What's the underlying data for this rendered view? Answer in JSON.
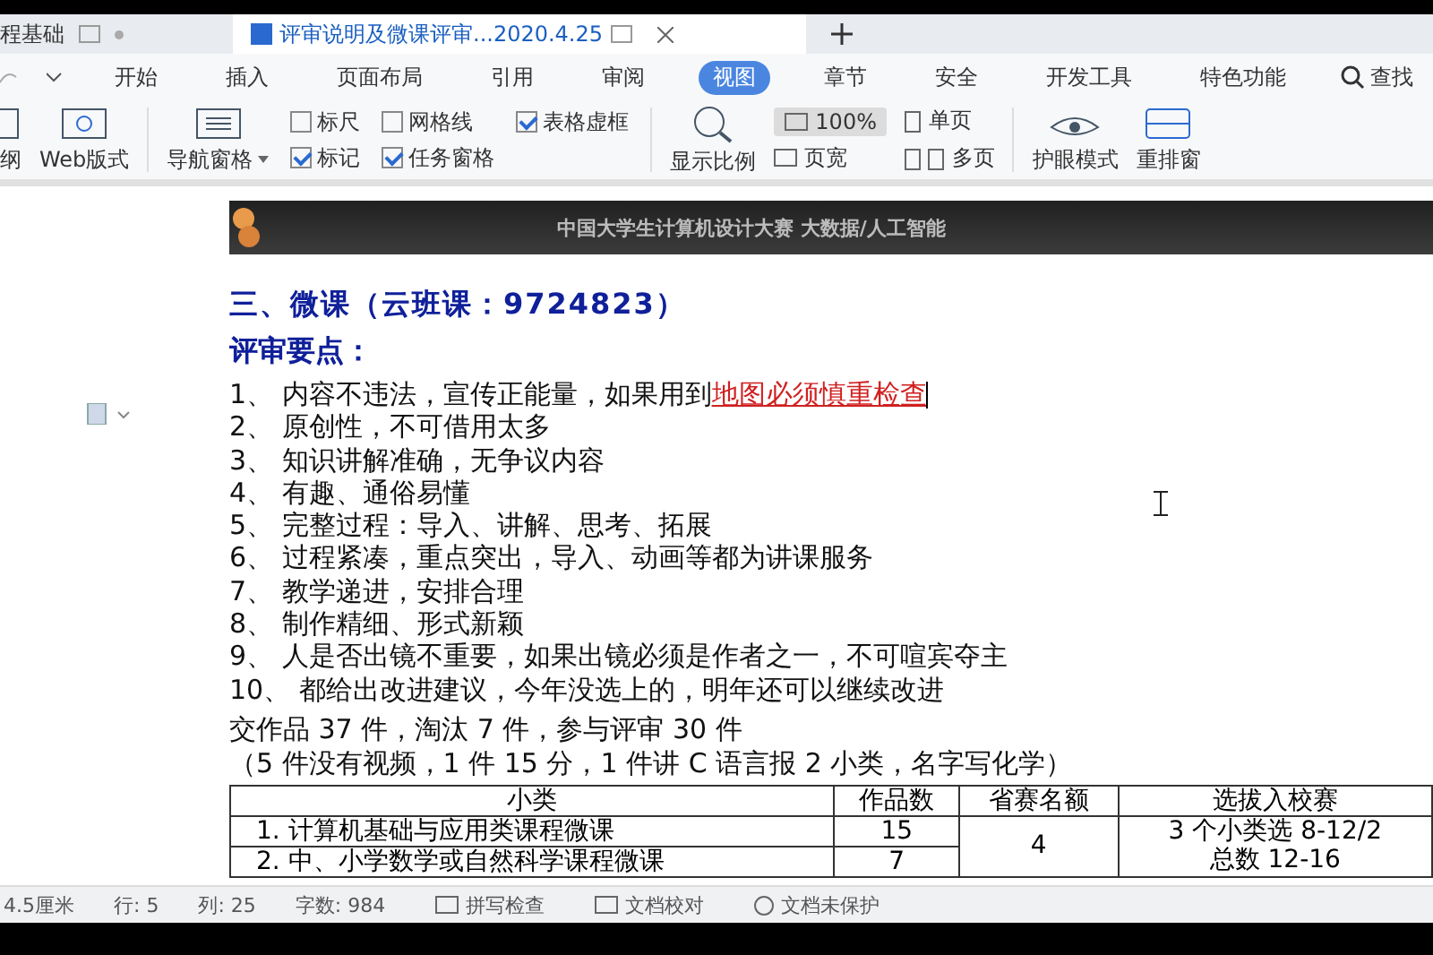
{
  "tabs": [
    {
      "label": "程基础",
      "selected": false
    },
    {
      "label": "评审说明及微课评审...2020.4.25",
      "selected": true
    }
  ],
  "menu": [
    {
      "label": "开始",
      "selected": false
    },
    {
      "label": "插入",
      "selected": false
    },
    {
      "label": "页面布局",
      "selected": false
    },
    {
      "label": "引用",
      "selected": false
    },
    {
      "label": "审阅",
      "selected": false
    },
    {
      "label": "视图",
      "selected": true
    },
    {
      "label": "章节",
      "selected": false
    },
    {
      "label": "安全",
      "selected": false
    },
    {
      "label": "开发工具",
      "selected": false
    },
    {
      "label": "特色功能",
      "selected": false
    }
  ],
  "search_label": "查找",
  "ribbon": {
    "outline": "纲",
    "web": "Web版式",
    "nav": "导航窗格",
    "checks": [
      {
        "label": "标尺",
        "checked": false
      },
      {
        "label": "网格线",
        "checked": false
      },
      {
        "label": "表格虚框",
        "checked": true
      },
      {
        "label": "标记",
        "checked": true
      },
      {
        "label": "任务窗格",
        "checked": true
      }
    ],
    "zoom": "显示比例",
    "zoom_value": "100%",
    "page_width": "页宽",
    "single": "单页",
    "multi": "多页",
    "eye": "护眼模式",
    "rearrange": "重排窗"
  },
  "banner": "中国大学生计算机设计大赛 大数据/人工智能",
  "heading": "三、微课（云班课：9724823）",
  "subheading": "评审要点：",
  "points": [
    {
      "text": "1、 内容不违法，宣传正能量，如果用到",
      "marked": "地图必须慎重检查"
    },
    {
      "text": "2、 原创性，不可借用太多"
    },
    {
      "text": "3、 知识讲解准确，无争议内容"
    },
    {
      "text": "4、 有趣、通俗易懂"
    },
    {
      "text": "5、 完整过程：导入、讲解、思考、拓展"
    },
    {
      "text": "6、 过程紧凑，重点突出，导入、动画等都为讲课服务"
    },
    {
      "text": "7、 教学递进，安排合理"
    },
    {
      "text": "8、 制作精细、形式新颖"
    },
    {
      "text": "9、 人是否出镜不重要，如果出镜必须是作者之一，不可喧宾夺主"
    },
    {
      "text": "10、 都给出改进建议，今年没选上的，明年还可以继续改进"
    }
  ],
  "summary": "交作品 37 件，淘汰 7 件，参与评审 30 件",
  "note": "（5 件没有视频，1 件 15 分，1 件讲 C 语言报 2 小类，名字写化学）",
  "table": {
    "columns": [
      "小类",
      "作品数",
      "省赛名额",
      "选拔入校赛"
    ],
    "rows": [
      [
        "1. 计算机基础与应用类课程微课",
        "15"
      ],
      [
        "2. 中、小学数学或自然科学课程微课",
        "7"
      ]
    ],
    "merged_quota": "4",
    "merged_select": [
      "3 个小类选 8-12/2",
      "总数 12-16"
    ]
  },
  "status": {
    "left": "4.5厘米",
    "row": "行: 5",
    "col": "列: 25",
    "words": "字数: 984",
    "spell": "拼写检查",
    "proof": "文档校对",
    "protect": "文档未保护"
  }
}
